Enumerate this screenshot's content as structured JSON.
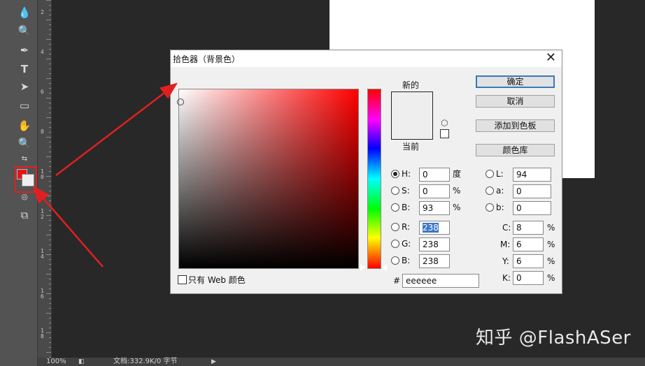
{
  "ruler": {
    "labels": [
      {
        "text": "2"
      },
      {
        "text": "4"
      },
      {
        "text": "6"
      },
      {
        "text": "8"
      },
      {
        "text": "1\n0"
      },
      {
        "text": "1\n2"
      },
      {
        "text": "1\n4"
      },
      {
        "text": "1\n6"
      },
      {
        "text": "1\n8"
      }
    ]
  },
  "tools": [
    "drop-tool-icon",
    "zoom-tool-icon",
    "pen-tool-icon",
    "type-tool-icon",
    "path-select-tool-icon",
    "rectangle-tool-icon",
    "hand-tool-icon",
    "zoom-tool-icon"
  ],
  "dialog": {
    "title": "拾色器（背景色）",
    "close": "✕",
    "new_label": "新的",
    "current_label": "当前",
    "buttons": {
      "ok": "确定",
      "cancel": "取消",
      "add_swatch": "添加到色板",
      "libraries": "颜色库"
    },
    "hsb": {
      "h": {
        "label": "H:",
        "value": "0",
        "unit": "度"
      },
      "s": {
        "label": "S:",
        "value": "0",
        "unit": "%"
      },
      "b": {
        "label": "B:",
        "value": "93",
        "unit": "%"
      }
    },
    "rgb": {
      "r": {
        "label": "R:",
        "value": "238"
      },
      "g": {
        "label": "G:",
        "value": "238"
      },
      "b": {
        "label": "B:",
        "value": "238"
      }
    },
    "lab": {
      "l": {
        "label": "L:",
        "value": "94"
      },
      "a": {
        "label": "a:",
        "value": "0"
      },
      "b": {
        "label": "b:",
        "value": "0"
      }
    },
    "cmyk": {
      "c": {
        "label": "C:",
        "value": "8",
        "unit": "%"
      },
      "m": {
        "label": "M:",
        "value": "6",
        "unit": "%"
      },
      "y": {
        "label": "Y:",
        "value": "6",
        "unit": "%"
      },
      "k": {
        "label": "K:",
        "value": "0",
        "unit": "%"
      }
    },
    "hex_label": "#",
    "hex_value": "eeeeee",
    "web_only": "只有 Web 颜色",
    "colors": {
      "new": "#eeeeee",
      "current": "#eeeeee",
      "hue_base": "#ff0000"
    }
  },
  "status": {
    "zoom": "100%",
    "doc_info": "文档:332.9K/0 字节"
  },
  "watermark": "知乎 @FlashASer",
  "annotation_color": "#e02020"
}
